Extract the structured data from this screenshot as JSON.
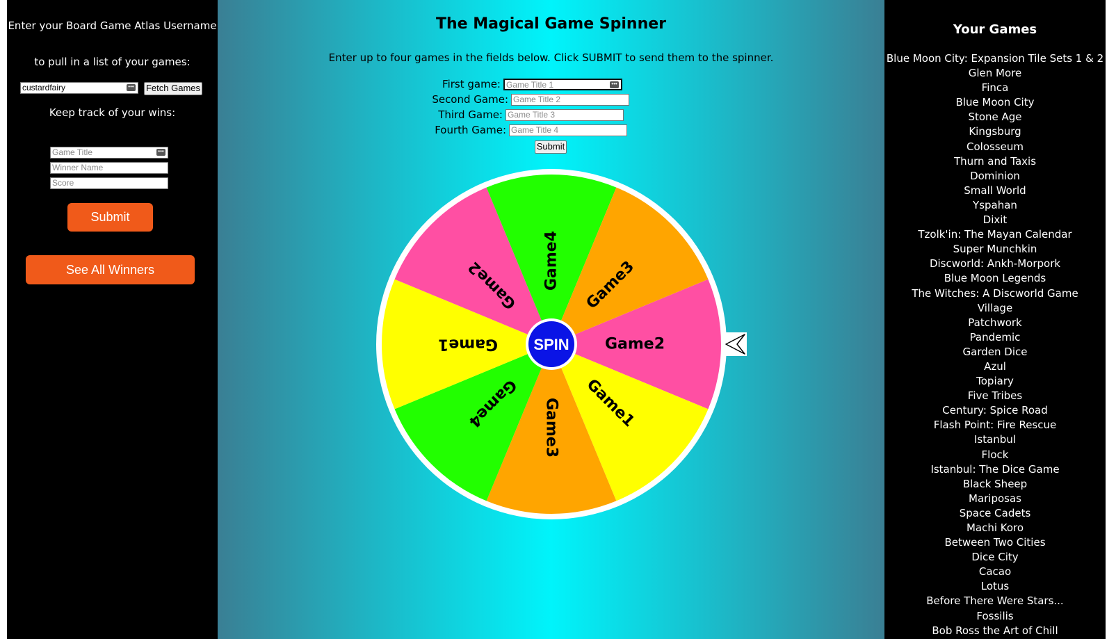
{
  "left_panel": {
    "username_prompt_1": "Enter your Board Game Atlas Username",
    "username_prompt_2": "to pull in a list of your games:",
    "username_value": "custardfairy",
    "fetch_button": "Fetch Games",
    "wins_heading": "Keep track of your wins:",
    "game_title_placeholder": "Game Title",
    "winner_name_placeholder": "Winner Name",
    "score_placeholder": "Score",
    "submit_button": "Submit",
    "see_winners_button": "See All Winners",
    "button_color": "#f05a1a"
  },
  "main": {
    "title": "The Magical Game Spinner",
    "instructions": "Enter up to four games in the fields below. Click SUBMIT to send them to the spinner.",
    "fields": [
      {
        "label": "First game:",
        "placeholder": "Game Title 1"
      },
      {
        "label": "Second Game:",
        "placeholder": "Game Title 2"
      },
      {
        "label": "Third Game:",
        "placeholder": "Game Title 3"
      },
      {
        "label": "Fourth Game:",
        "placeholder": "Game Title 4"
      }
    ],
    "submit_button": "Submit"
  },
  "wheel": {
    "spin_label": "SPIN",
    "spin_color": "#0a14e6",
    "segments": [
      {
        "label": "Game2",
        "color": "#ff4fa3"
      },
      {
        "label": "Game1",
        "color": "#ffff00"
      },
      {
        "label": "Game3",
        "color": "#ffa500"
      },
      {
        "label": "Game4",
        "color": "#22ff00"
      },
      {
        "label": "Game1",
        "color": "#ffff00"
      },
      {
        "label": "Game2",
        "color": "#ff4fa3"
      },
      {
        "label": "Game4",
        "color": "#22ff00"
      },
      {
        "label": "Game3",
        "color": "#ffa500"
      }
    ],
    "pointer_icon": "arrow-pointer-icon"
  },
  "right_panel": {
    "title": "Your Games",
    "games": [
      "Blue Moon City: Expansion Tile Sets 1 & 2",
      "Glen More",
      "Finca",
      "Blue Moon City",
      "Stone Age",
      "Kingsburg",
      "Colosseum",
      "Thurn and Taxis",
      "Dominion",
      "Small World",
      "Yspahan",
      "Dixit",
      "Tzolk'in: The Mayan Calendar",
      "Super Munchkin",
      "Discworld: Ankh-Morpork",
      "Blue Moon Legends",
      "The Witches: A Discworld Game",
      "Village",
      "Patchwork",
      "Pandemic",
      "Garden Dice",
      "Azul",
      "Topiary",
      "Five Tribes",
      "Century: Spice Road",
      "Flash Point: Fire Rescue",
      "Istanbul",
      "Flock",
      "Istanbul: The Dice Game",
      "Black Sheep",
      "Mariposas",
      "Space Cadets",
      "Machi Koro",
      "Between Two Cities",
      "Dice City",
      "Cacao",
      "Lotus",
      "Before There Were Stars...",
      "Fossilis",
      "Bob Ross the Art of Chill"
    ]
  }
}
